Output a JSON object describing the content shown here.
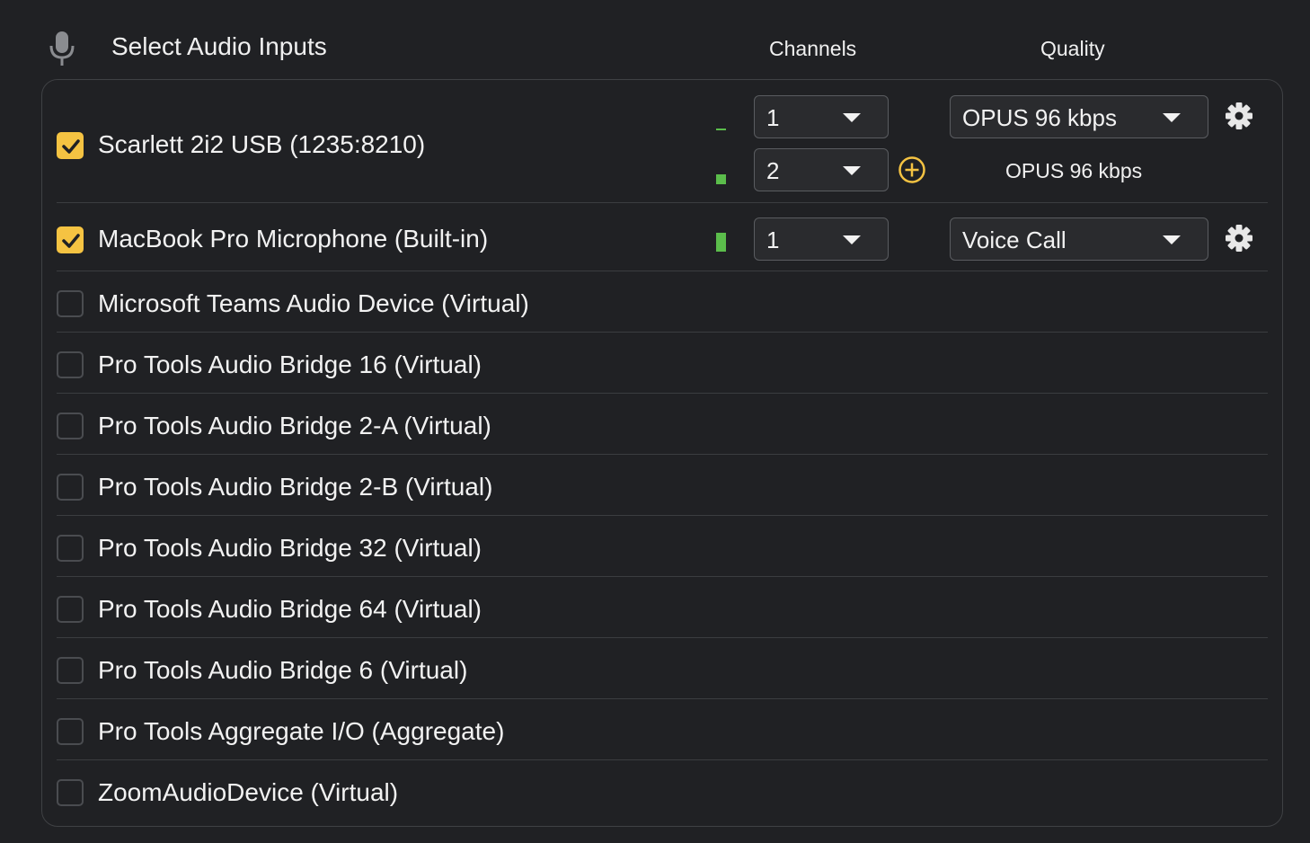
{
  "header": {
    "title": "Select Audio Inputs",
    "icon": "microphone-icon",
    "columns": {
      "channels": "Channels",
      "quality": "Quality"
    }
  },
  "colors": {
    "accent": "#f5c342",
    "meter": "#5bbd4b",
    "background": "#202124"
  },
  "devices": [
    {
      "name": "Scarlett 2i2 USB (1235:8210)",
      "checked": true,
      "channels": [
        {
          "value": "1",
          "quality": "OPUS 96 kbps",
          "level": 0.08
        },
        {
          "value": "2",
          "quality": "OPUS 96 kbps",
          "level": 0.25
        }
      ]
    },
    {
      "name": "MacBook Pro Microphone (Built-in)",
      "checked": true,
      "channels": [
        {
          "value": "1",
          "quality": "Voice Call",
          "level": 0.45
        }
      ]
    },
    {
      "name": "Microsoft Teams Audio Device (Virtual)",
      "checked": false
    },
    {
      "name": "Pro Tools Audio Bridge 16 (Virtual)",
      "checked": false
    },
    {
      "name": "Pro Tools Audio Bridge 2-A (Virtual)",
      "checked": false
    },
    {
      "name": "Pro Tools Audio Bridge 2-B (Virtual)",
      "checked": false
    },
    {
      "name": "Pro Tools Audio Bridge 32 (Virtual)",
      "checked": false
    },
    {
      "name": "Pro Tools Audio Bridge 64 (Virtual)",
      "checked": false
    },
    {
      "name": "Pro Tools Audio Bridge 6 (Virtual)",
      "checked": false
    },
    {
      "name": "Pro Tools Aggregate I/O (Aggregate)",
      "checked": false
    },
    {
      "name": "ZoomAudioDevice (Virtual)",
      "checked": false
    }
  ]
}
